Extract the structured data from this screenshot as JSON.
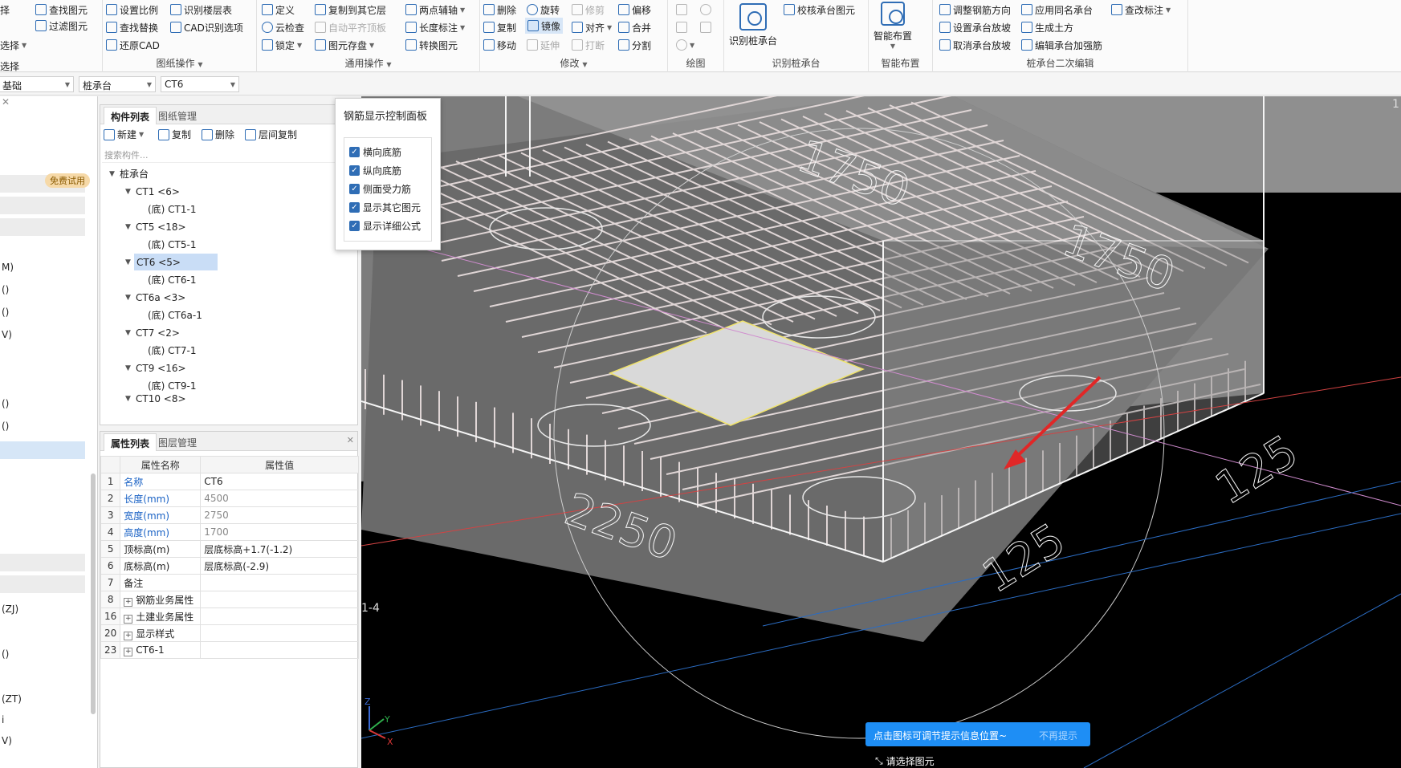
{
  "ribbon": {
    "group1": {
      "items": [
        "查找图元",
        "过滤图元"
      ],
      "left_partial": [
        "择",
        "选择"
      ]
    },
    "group2": {
      "label": "图纸操作",
      "items": [
        "设置比例",
        "识别楼层表",
        "查找替换",
        "CAD识别选项",
        "还原CAD"
      ]
    },
    "group3": {
      "label": "通用操作",
      "items": [
        "定义",
        "复制到其它层",
        "两点辅轴",
        "云检查",
        "自动平齐顶板",
        "长度标注",
        "锁定",
        "图元存盘",
        "转换图元"
      ]
    },
    "group4": {
      "label": "修改",
      "items": [
        "删除",
        "旋转",
        "修剪",
        "偏移",
        "复制",
        "镜像",
        "对齐",
        "合并",
        "移动",
        "延伸",
        "打断",
        "分割"
      ]
    },
    "group5": {
      "label": "绘图"
    },
    "group6": {
      "label": "识别桩承台",
      "items": [
        "识别桩承台",
        "校核承台图元"
      ]
    },
    "group7": {
      "label": "智能布置",
      "items": [
        "智能布置"
      ]
    },
    "group8": {
      "label": "桩承台二次编辑",
      "items": [
        "调整钢筋方向",
        "应用同名承台",
        "查改标注",
        "设置承台放坡",
        "生成土方",
        "取消承台放坡",
        "编辑承台加强筋"
      ]
    }
  },
  "selectors": {
    "floor": "基础",
    "type": "桩承台",
    "component": "CT6"
  },
  "left_panel": {
    "trial_badge": "免费试用",
    "fragments": [
      "M)",
      "()",
      "()",
      "V)",
      "()",
      "()",
      "(ZJ)",
      "()",
      "(ZT)",
      "i",
      "V)"
    ]
  },
  "comp_panel": {
    "tabs": [
      "构件列表",
      "图纸管理"
    ],
    "toolbar": [
      "新建",
      "复制",
      "删除",
      "层间复制"
    ],
    "search_placeholder": "搜索构件...",
    "tree": {
      "root": "桩承台",
      "items": [
        {
          "label": "CT1 <6>",
          "child": "(底) CT1-1"
        },
        {
          "label": "CT5 <18>",
          "child": "(底) CT5-1"
        },
        {
          "label": "CT6 <5>",
          "child": "(底) CT6-1"
        },
        {
          "label": "CT6a <3>",
          "child": "(底) CT6a-1"
        },
        {
          "label": "CT7 <2>",
          "child": "(底) CT7-1"
        },
        {
          "label": "CT9 <16>",
          "child": "(底) CT9-1"
        }
      ],
      "cut_item": "CT10 <8>"
    }
  },
  "prop_panel": {
    "tabs": [
      "属性列表",
      "图层管理"
    ],
    "headers": [
      "属性名称",
      "属性值"
    ],
    "rows": [
      {
        "num": "1",
        "name": "名称",
        "value": "CT6",
        "blue": true
      },
      {
        "num": "2",
        "name": "长度(mm)",
        "value": "4500",
        "blue": true
      },
      {
        "num": "3",
        "name": "宽度(mm)",
        "value": "2750",
        "blue": true
      },
      {
        "num": "4",
        "name": "高度(mm)",
        "value": "1700",
        "blue": true
      },
      {
        "num": "5",
        "name": "顶标高(m)",
        "value": "层底标高+1.7(-1.2)"
      },
      {
        "num": "6",
        "name": "底标高(m)",
        "value": "层底标高(-2.9)"
      },
      {
        "num": "7",
        "name": "备注",
        "value": ""
      },
      {
        "num": "8",
        "name": "钢筋业务属性",
        "value": "",
        "expand": true
      },
      {
        "num": "16",
        "name": "土建业务属性",
        "value": "",
        "expand": true
      },
      {
        "num": "20",
        "name": "显示样式",
        "value": "",
        "expand": true
      },
      {
        "num": "23",
        "name": "CT6-1",
        "value": "",
        "expand": true
      }
    ]
  },
  "rebar_panel": {
    "title": "钢筋显示控制面板",
    "options": [
      "横向底筋",
      "纵向底筋",
      "侧面受力筋",
      "显示其它图元",
      "显示详细公式"
    ]
  },
  "viewport": {
    "dims": [
      "1750",
      "1750",
      "2250",
      "125",
      "125"
    ],
    "axis_label": "1-4",
    "corner_label": "1"
  },
  "hint": {
    "message": "点击图标可调节提示信息位置~",
    "dismiss": "不再提示"
  },
  "status": {
    "text": "请选择图元"
  }
}
